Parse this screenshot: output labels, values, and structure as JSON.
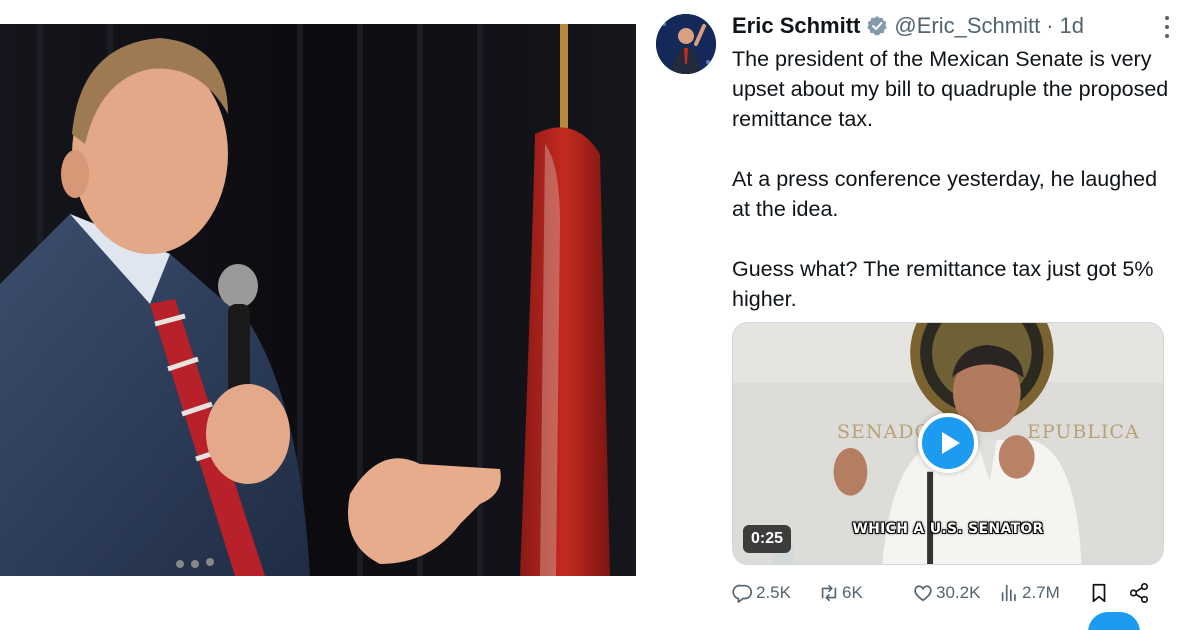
{
  "tweet": {
    "display_name": "Eric Schmitt",
    "handle": "@Eric_Schmitt",
    "separator": "·",
    "time": "1d",
    "verified": true,
    "paragraphs": [
      "The president of the Mexican Senate is very upset about my bill to quadruple the proposed remittance tax.",
      "At a press conference yesterday, he laughed at the idea.",
      "Guess what? The remittance tax just got 5% higher."
    ]
  },
  "media": {
    "duration": "0:25",
    "caption": "WHICH A U.S. SENATOR",
    "sign_left": "SENADO",
    "sign_right": "EPUBLICA"
  },
  "actions": {
    "replies": "2.5K",
    "reposts": "6K",
    "likes": "30.2K",
    "views": "2.7M"
  },
  "colors": {
    "accent": "#1d9bf0",
    "text_primary": "#0f1419",
    "text_secondary": "#536471"
  },
  "icons": [
    "verified-badge-icon",
    "more-options-icon",
    "play-icon",
    "reply-icon",
    "repost-icon",
    "like-icon",
    "views-icon",
    "bookmark-icon",
    "share-icon"
  ]
}
